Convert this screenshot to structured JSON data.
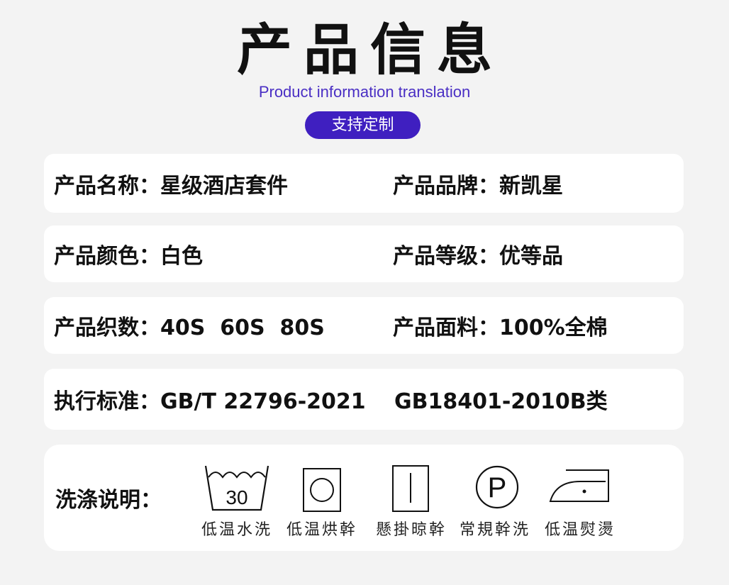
{
  "header": {
    "title": "产品信息",
    "subtitle": "Product information translation",
    "badge": "支持定制"
  },
  "rows": [
    {
      "left": "产品名称：星级酒店套件",
      "right": "产品品牌：新凯星"
    },
    {
      "left": "产品颜色：白色",
      "right": "产品等级：优等品"
    },
    {
      "left": "产品织数：40S  60S  80S",
      "right": "产品面料：100%全棉"
    },
    {
      "left": "执行标准：GB/T 22796-2021",
      "right": "GB18401-2010B类"
    }
  ],
  "care": {
    "label": "洗涤说明：",
    "symbols": [
      {
        "icon": "wash-30-icon",
        "text": "30",
        "label": "低温水洗"
      },
      {
        "icon": "tumble-dry-low-icon",
        "label": "低温烘幹"
      },
      {
        "icon": "line-dry-icon",
        "label": "懸掛晾幹"
      },
      {
        "icon": "dry-clean-p-icon",
        "text": "P",
        "label": "常規幹洗"
      },
      {
        "icon": "iron-low-icon",
        "label": "低温熨燙"
      }
    ]
  },
  "colors": {
    "accent": "#3f1fc0",
    "subtitle": "#4a2fc4",
    "background": "#f3f3f3",
    "card": "#ffffff"
  }
}
